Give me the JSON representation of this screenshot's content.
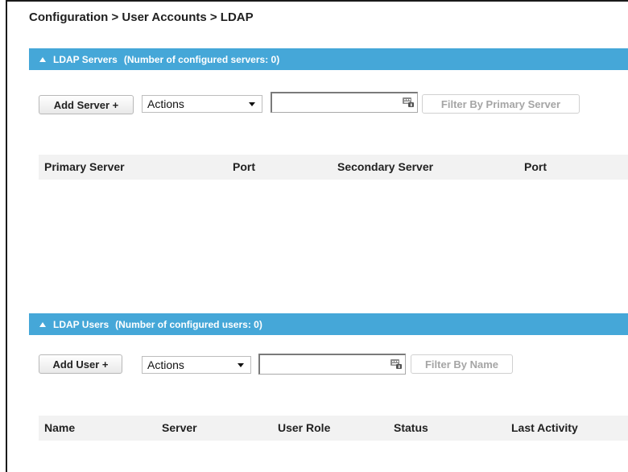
{
  "breadcrumb": "Configuration > User Accounts > LDAP",
  "servers": {
    "title": "LDAP Servers",
    "count_text": "(Number of configured servers: 0)",
    "add_button": "Add Server +",
    "actions": "Actions",
    "filter_value": "",
    "filter_button": "Filter By Primary Server",
    "columns": [
      "Primary Server",
      "Port",
      "Secondary Server",
      "Port"
    ]
  },
  "users": {
    "title": "LDAP Users",
    "count_text": "(Number of configured users: 0)",
    "add_button": "Add User +",
    "actions": "Actions",
    "filter_value": "",
    "filter_button": "Filter By Name",
    "columns": [
      "Name",
      "Server",
      "User Role",
      "Status",
      "Last Activity"
    ]
  },
  "colors": {
    "section_bar": "#45a7d8",
    "table_header": "#f2f2f2"
  },
  "icons": {
    "collapse": "collapse-triangle-icon",
    "keyboard": "virtual-keyboard-icon"
  }
}
